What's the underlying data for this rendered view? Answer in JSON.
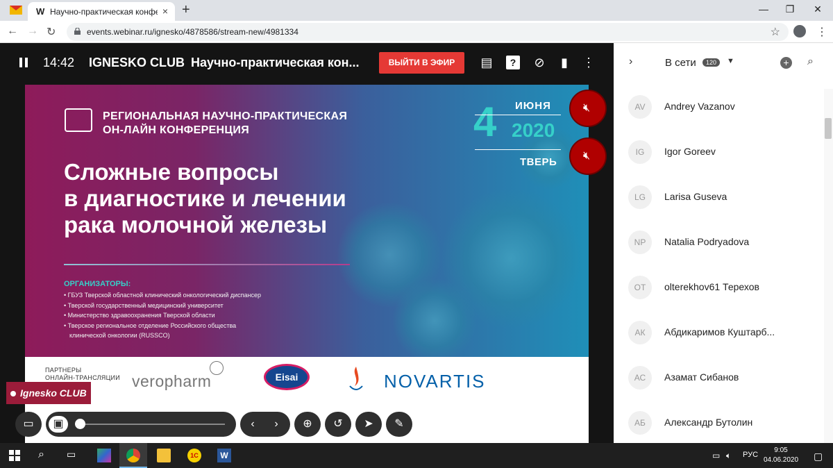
{
  "browser": {
    "tab_title": "Научно-практическая конфере",
    "tab_favicon_letter": "W",
    "new_tab": "+",
    "close_tab": "×",
    "url": "events.webinar.ru/ignesko/4878586/stream-new/4981334",
    "window_controls": [
      "—",
      "❐",
      "✕"
    ]
  },
  "player": {
    "time": "14:42",
    "club": "IGNESKO CLUB",
    "conference_title": "Научно-практическая кон...",
    "exit_label": "ВЫЙТИ В ЭФИР"
  },
  "slide": {
    "regional_line1": "РЕГИОНАЛЬНАЯ НАУЧНО-ПРАКТИЧЕСКАЯ",
    "regional_line2": "ОН-ЛАЙН КОНФЕРЕНЦИЯ",
    "date_day": "4",
    "date_month": "ИЮНЯ",
    "date_year": "2020",
    "date_city": "ТВЕРЬ",
    "headline_1": "Сложные вопросы",
    "headline_2": "в диагностике и лечении",
    "headline_3": "рака молочной железы",
    "organizers_title": "ОРГАНИЗАТОРЫ:",
    "organizers": [
      "• ГБУЗ Тверской областной клинический онкологический диспансер",
      "• Тверской государственный медицинский университет",
      "• Министерство здравоохранения Тверской области",
      "• Тверское региональное отделение Российского общества",
      "клинической онкологии (RUSSCO)"
    ],
    "partners_line1": "ПАРТНЕРЫ",
    "partners_line2": "ОНЛАЙН-ТРАНСЛЯЦИИ",
    "partner_vero": "veropharm",
    "partner_eisai": "Eisai",
    "partner_novartis": "NOVARTIS",
    "watermark": "Ignesko CLUB"
  },
  "panel": {
    "online_label": "В сети",
    "online_count": "120",
    "participants": [
      {
        "initials": "AV",
        "name": "Andrey Vazanov"
      },
      {
        "initials": "IG",
        "name": "Igor Goreev"
      },
      {
        "initials": "LG",
        "name": "Larisa Guseva"
      },
      {
        "initials": "NP",
        "name": "Natalia Podryadova"
      },
      {
        "initials": "OT",
        "name": "olterekhov61 Терехов"
      },
      {
        "initials": "АК",
        "name": "Абдикаримов Куштарб..."
      },
      {
        "initials": "АС",
        "name": "Азамат Сибанов"
      },
      {
        "initials": "АБ",
        "name": "Александр Бутолин"
      }
    ]
  },
  "taskbar": {
    "lang": "РУС",
    "clock_time": "9:05",
    "clock_date": "04.06.2020",
    "app_1c": "1С",
    "app_word": "W"
  }
}
